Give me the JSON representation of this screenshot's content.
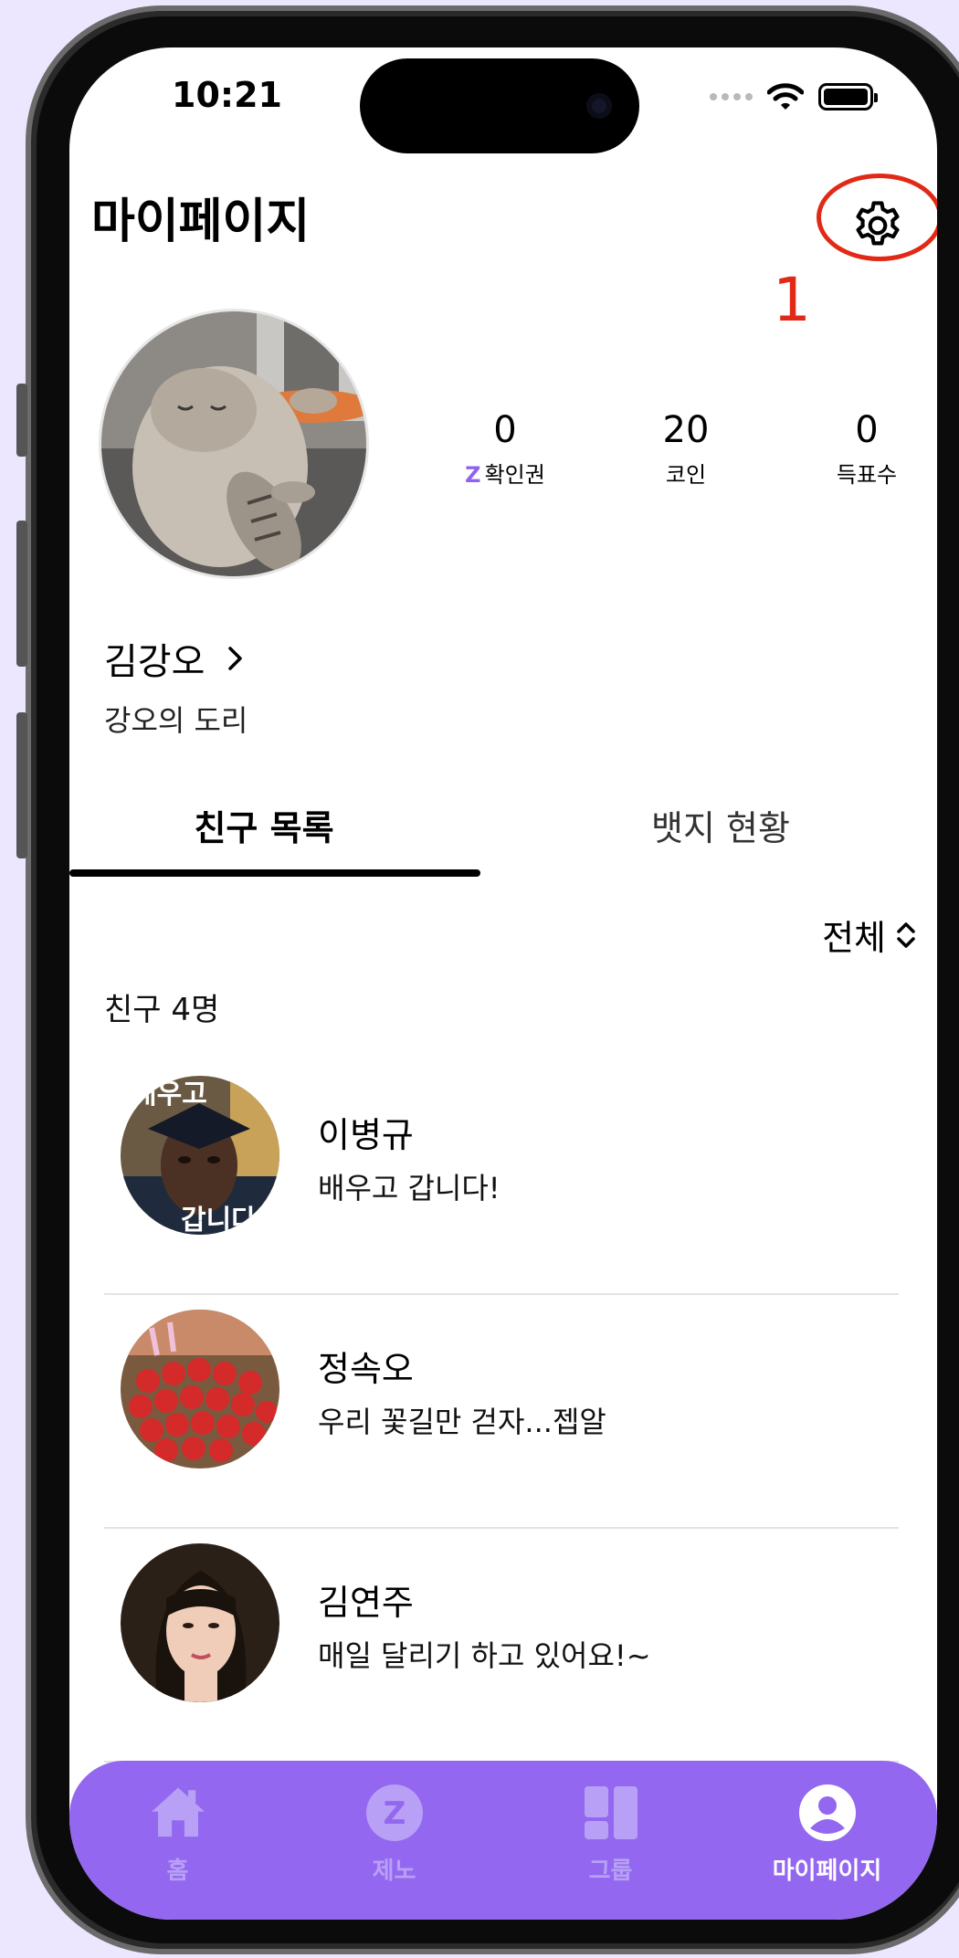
{
  "status_bar": {
    "time": "10:21"
  },
  "header": {
    "title": "마이페이지"
  },
  "annotation": {
    "number": "1"
  },
  "stats": [
    {
      "value": "0",
      "prefix": "Z",
      "label": "확인권"
    },
    {
      "value": "20",
      "prefix": "",
      "label": "코인"
    },
    {
      "value": "0",
      "prefix": "",
      "label": "득표수"
    }
  ],
  "profile": {
    "name": "김강오",
    "bio": "강오의 도리"
  },
  "tabs": [
    {
      "label": "친구 목록",
      "active": true
    },
    {
      "label": "뱃지 현황",
      "active": false
    }
  ],
  "filter": {
    "label": "전체"
  },
  "friends": {
    "count_label": "친구 4명",
    "items": [
      {
        "name": "이병규",
        "message": "배우고 갑니다!",
        "avatar_text_top": "배우고",
        "avatar_text_bottom": "갑니다"
      },
      {
        "name": "정속오",
        "message": "우리 꽃길만 걷자...젭알"
      },
      {
        "name": "김연주",
        "message": "매일 달리기 하고 있어요!~"
      }
    ]
  },
  "nav": [
    {
      "label": "홈",
      "icon": "home-icon"
    },
    {
      "label": "제노",
      "icon": "zeno-icon",
      "glyph": "Z"
    },
    {
      "label": "그룹",
      "icon": "group-icon"
    },
    {
      "label": "마이페이지",
      "icon": "profile-icon",
      "active": true
    }
  ],
  "colors": {
    "accent": "#9367ef",
    "annotation": "#e02a17",
    "nav_inactive": "#b8a0f6"
  }
}
